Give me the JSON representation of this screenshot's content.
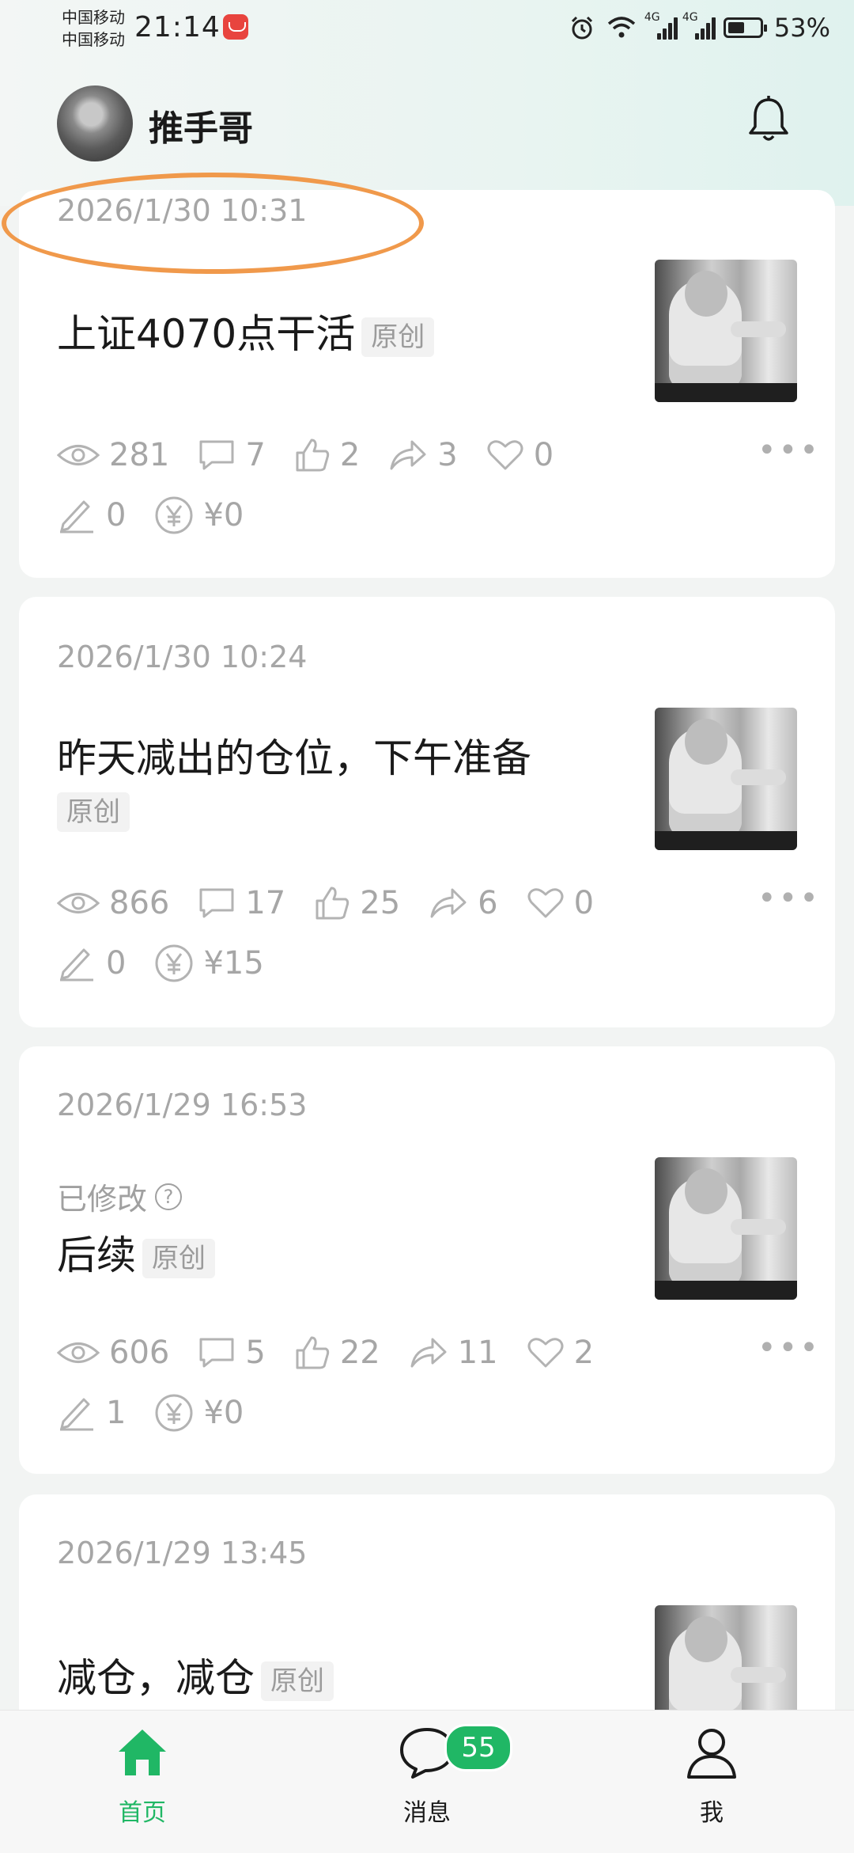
{
  "status_bar": {
    "carrier_1": "中国移动",
    "carrier_2": "中国移动",
    "time": "21:14",
    "network_1": "4G",
    "network_2": "4G",
    "battery_percent": "53%",
    "battery_level": 0.53
  },
  "header": {
    "username": "推手哥"
  },
  "posts": [
    {
      "date": "2026/1/30 10:31",
      "title": "上证4070点干活",
      "tag": "原创",
      "views": "281",
      "comments": "7",
      "likes": "2",
      "shares": "3",
      "favorites": "0",
      "edits": "0",
      "reward": "¥0"
    },
    {
      "date": "2026/1/30 10:24",
      "title": "昨天减出的仓位，下午准备",
      "tag": "原创",
      "views": "866",
      "comments": "17",
      "likes": "25",
      "shares": "6",
      "favorites": "0",
      "edits": "0",
      "reward": "¥15"
    },
    {
      "date": "2026/1/29 16:53",
      "edited_label": "已修改",
      "title": "后续",
      "tag": "原创",
      "views": "606",
      "comments": "5",
      "likes": "22",
      "shares": "11",
      "favorites": "2",
      "edits": "1",
      "reward": "¥0"
    },
    {
      "date": "2026/1/29 13:45",
      "title": "减仓，减仓",
      "tag": "原创"
    }
  ],
  "bottom_nav": {
    "home": "首页",
    "messages": "消息",
    "me": "我",
    "messages_badge": "55"
  },
  "colors": {
    "accent": "#20b765",
    "highlight_ring": "#f0994b"
  },
  "icons": [
    "alarm-icon",
    "wifi-icon",
    "signal-icon",
    "battery-icon",
    "bell-icon",
    "eye-icon",
    "comment-icon",
    "thumb-up-icon",
    "share-icon",
    "heart-icon",
    "pencil-icon",
    "yuan-icon",
    "more-icon",
    "home-icon",
    "chat-icon",
    "person-icon"
  ]
}
